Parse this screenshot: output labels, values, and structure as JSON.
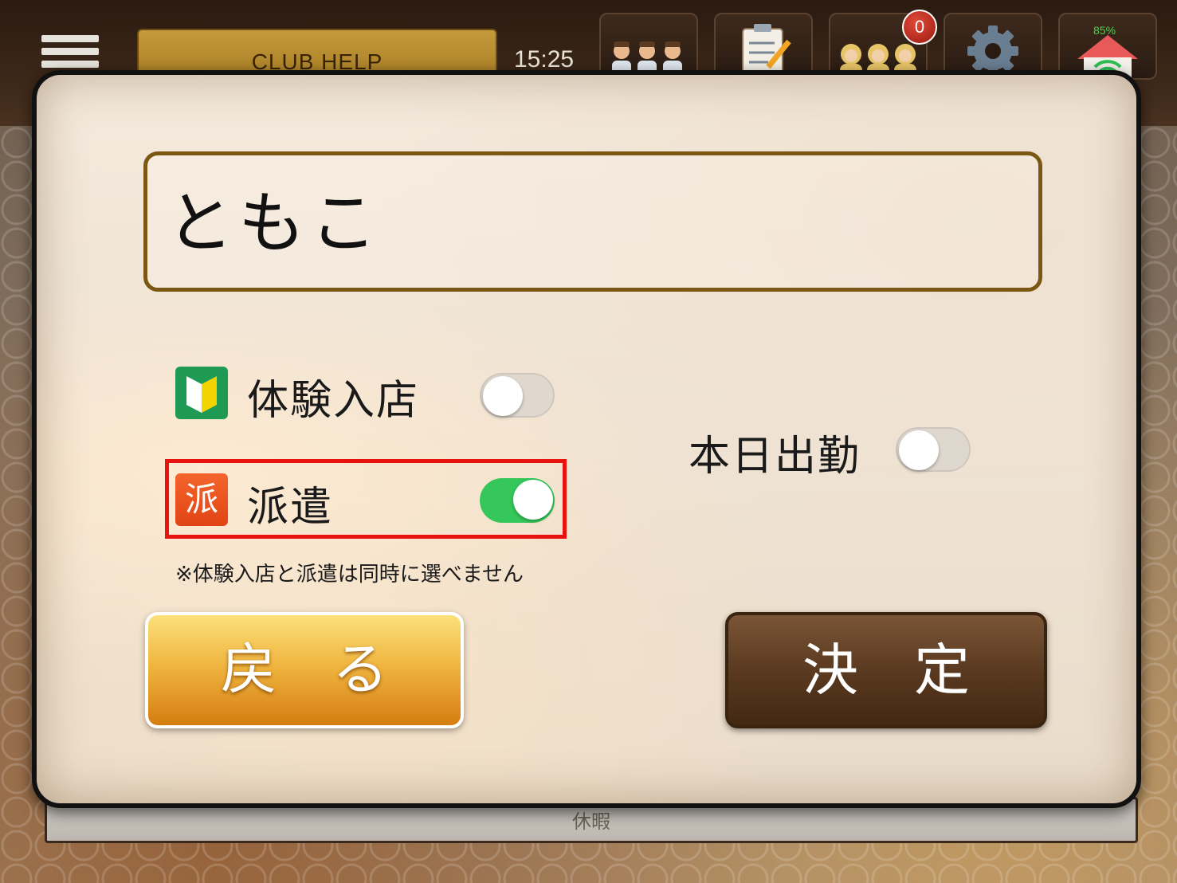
{
  "topbar": {
    "club_label": "CLUB HELP",
    "clock": "15:25",
    "notification_count": "0",
    "battery": "85%"
  },
  "modal": {
    "name_value": "ともこ",
    "options": {
      "trial": {
        "label": "体験入店",
        "enabled": false
      },
      "dispatch": {
        "label": "派遣",
        "icon_text": "派",
        "enabled": true
      },
      "attendance": {
        "label": "本日出勤",
        "enabled": false
      }
    },
    "note": "※体験入店と派遣は同時に選べません",
    "back_label": "戻る",
    "ok_label": "決定"
  },
  "under_strip": {
    "label": "休暇"
  },
  "colors": {
    "toggle_on": "#35c759",
    "highlight": "#e8120f",
    "back_button": "#f0b640",
    "ok_button": "#5a3a20"
  }
}
